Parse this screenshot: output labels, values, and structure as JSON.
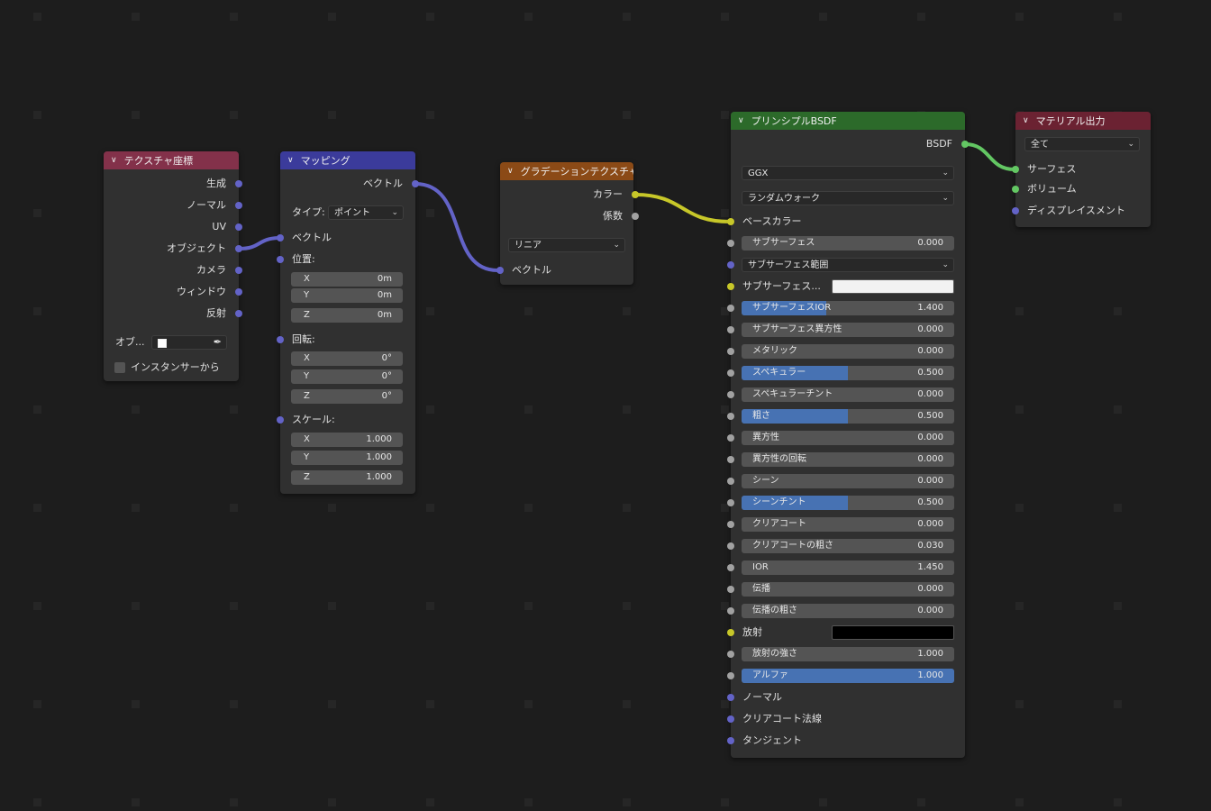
{
  "nodes": {
    "tex_coord": {
      "title": "テクスチャ座標",
      "outputs": [
        "生成",
        "ノーマル",
        "UV",
        "オブジェクト",
        "カメラ",
        "ウィンドウ",
        "反射"
      ],
      "object_label": "オブ...",
      "instancer_label": "インスタンサーから",
      "header_color": "#83314a"
    },
    "mapping": {
      "title": "マッピング",
      "output": "ベクトル",
      "type_label": "タイプ:",
      "type_value": "ポイント",
      "vector_label": "ベクトル",
      "location_label": "位置:",
      "location": [
        {
          "axis": "X",
          "value": "0m"
        },
        {
          "axis": "Y",
          "value": "0m"
        },
        {
          "axis": "Z",
          "value": "0m"
        }
      ],
      "rotation_label": "回転:",
      "rotation": [
        {
          "axis": "X",
          "value": "0°"
        },
        {
          "axis": "Y",
          "value": "0°"
        },
        {
          "axis": "Z",
          "value": "0°"
        }
      ],
      "scale_label": "スケール:",
      "scale": [
        {
          "axis": "X",
          "value": "1.000"
        },
        {
          "axis": "Y",
          "value": "1.000"
        },
        {
          "axis": "Z",
          "value": "1.000"
        }
      ],
      "header_color": "#3b3b9b"
    },
    "gradient": {
      "title": "グラデーションテクスチャ",
      "out_color": "カラー",
      "out_fac": "係数",
      "type_value": "リニア",
      "in_vector": "ベクトル",
      "header_color": "#8b4a16"
    },
    "bsdf": {
      "title": "プリンシプルBSDF",
      "output": "BSDF",
      "distribution": "GGX",
      "subsurface_method": "ランダムウォーク",
      "base_color_label": "ベースカラー",
      "header_color": "#2c6a2a",
      "rows": [
        {
          "kind": "field",
          "label": "サブサーフェス",
          "value": "0.000",
          "fill": 0,
          "socket": "gray"
        },
        {
          "kind": "select",
          "label": "サブサーフェス範囲",
          "socket": "purple"
        },
        {
          "kind": "color",
          "label": "サブサーフェス...",
          "color": "#f2f2f2",
          "socket": "yellow"
        },
        {
          "kind": "field",
          "label": "サブサーフェスIOR",
          "value": "1.400",
          "fill": 0.4,
          "socket": "gray"
        },
        {
          "kind": "field",
          "label": "サブサーフェス異方性",
          "value": "0.000",
          "fill": 0,
          "socket": "gray"
        },
        {
          "kind": "field",
          "label": "メタリック",
          "value": "0.000",
          "fill": 0,
          "socket": "gray"
        },
        {
          "kind": "field",
          "label": "スペキュラー",
          "value": "0.500",
          "fill": 0.5,
          "socket": "gray"
        },
        {
          "kind": "field",
          "label": "スペキュラーチント",
          "value": "0.000",
          "fill": 0,
          "socket": "gray"
        },
        {
          "kind": "field",
          "label": "粗さ",
          "value": "0.500",
          "fill": 0.5,
          "socket": "gray"
        },
        {
          "kind": "field",
          "label": "異方性",
          "value": "0.000",
          "fill": 0,
          "socket": "gray"
        },
        {
          "kind": "field",
          "label": "異方性の回転",
          "value": "0.000",
          "fill": 0,
          "socket": "gray"
        },
        {
          "kind": "field",
          "label": "シーン",
          "value": "0.000",
          "fill": 0,
          "socket": "gray"
        },
        {
          "kind": "field",
          "label": "シーンチント",
          "value": "0.500",
          "fill": 0.5,
          "socket": "gray"
        },
        {
          "kind": "field",
          "label": "クリアコート",
          "value": "0.000",
          "fill": 0,
          "socket": "gray"
        },
        {
          "kind": "field",
          "label": "クリアコートの粗さ",
          "value": "0.030",
          "fill": 0,
          "socket": "gray"
        },
        {
          "kind": "field",
          "label": "IOR",
          "value": "1.450",
          "fill": 0,
          "socket": "gray"
        },
        {
          "kind": "field",
          "label": "伝播",
          "value": "0.000",
          "fill": 0,
          "socket": "gray"
        },
        {
          "kind": "field",
          "label": "伝播の粗さ",
          "value": "0.000",
          "fill": 0,
          "socket": "gray"
        },
        {
          "kind": "color",
          "label": "放射",
          "color": "#000000",
          "socket": "yellow"
        },
        {
          "kind": "field",
          "label": "放射の強さ",
          "value": "1.000",
          "fill": 0,
          "socket": "gray"
        },
        {
          "kind": "field",
          "label": "アルファ",
          "value": "1.000",
          "fill": 1,
          "socket": "gray"
        },
        {
          "kind": "text",
          "label": "ノーマル",
          "socket": "purple"
        },
        {
          "kind": "text",
          "label": "クリアコート法線",
          "socket": "purple"
        },
        {
          "kind": "text",
          "label": "タンジェント",
          "socket": "purple"
        }
      ]
    },
    "output": {
      "title": "マテリアル出力",
      "target": "全て",
      "inputs": [
        "サーフェス",
        "ボリューム",
        "ディスプレイスメント"
      ],
      "header_color": "#6b2232"
    }
  },
  "colors": {
    "background": "#1d1d1d",
    "node_body": "#303030",
    "slider_fill": "#4772b3",
    "socket_vector": "#6363c7",
    "socket_color": "#c7c729",
    "socket_float": "#a1a1a1",
    "socket_shader": "#63c763"
  }
}
